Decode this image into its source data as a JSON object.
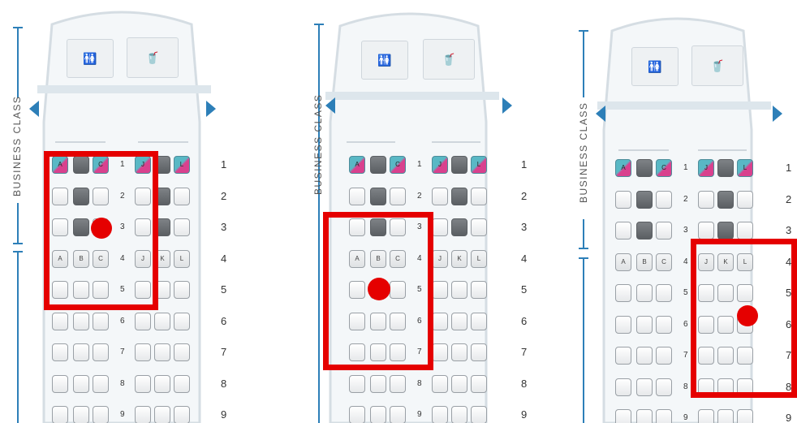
{
  "cabin_label": "BUSINESS CLASS",
  "facilities": {
    "lavatory_icon": "lavatory-icon",
    "drink_icon": "drink-icon"
  },
  "lavatory_glyph": "🚻",
  "drink_glyph": "🥤",
  "rows": [
    "1",
    "2",
    "3",
    "4",
    "5",
    "6",
    "7",
    "8",
    "9"
  ],
  "row1_letters": [
    "A",
    "",
    "C",
    "J",
    "",
    "L"
  ],
  "row4_letters": [
    "A",
    "B",
    "C",
    "J",
    "K",
    "L"
  ],
  "colors": {
    "highlight": "#e50000",
    "premium_teal": "#59b8c5",
    "premium_pink": "#d9418e",
    "occupied": "#6b6f73",
    "arrow": "#2d7fb8"
  },
  "panels": [
    {
      "name": "panel-left",
      "highlight_rows": [
        "1",
        "5"
      ],
      "selected_row": "3",
      "selected_seat": "C"
    },
    {
      "name": "panel-middle",
      "highlight_rows": [
        "3",
        "7"
      ],
      "selected_row": "5",
      "selected_seat": "B"
    },
    {
      "name": "panel-right",
      "highlight_rows": [
        "4",
        "8"
      ],
      "selected_row": "6",
      "selected_seat": "K"
    }
  ]
}
